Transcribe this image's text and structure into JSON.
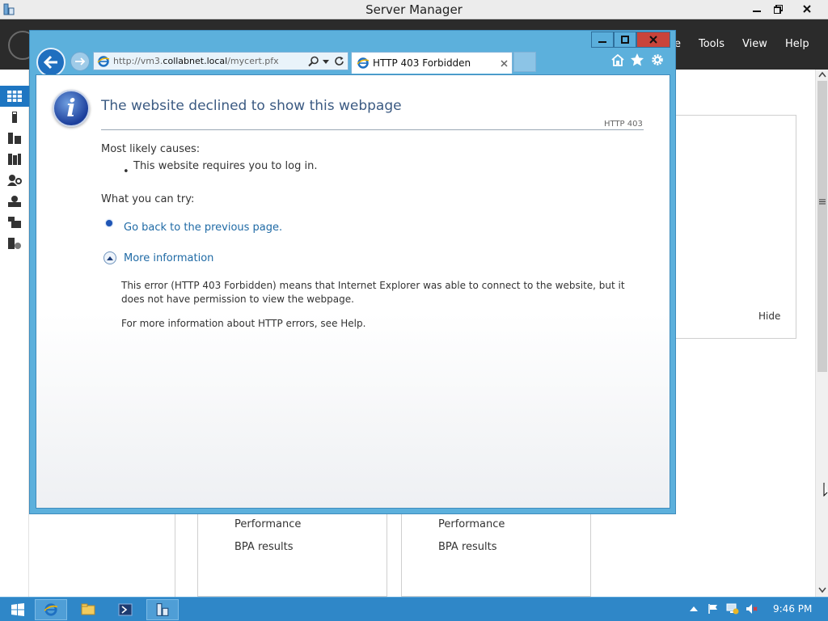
{
  "server_manager": {
    "title": "Server Manager",
    "menu": {
      "partial": "e",
      "tools": "Tools",
      "view": "View",
      "help": "Help"
    },
    "hide_link": "Hide",
    "tiles": [
      {
        "lines": [
          "Performance",
          "BPA results"
        ]
      },
      {
        "lines": [
          "Performance",
          "BPA results"
        ]
      }
    ],
    "nav_icons": [
      "dashboard-icon",
      "local-server-icon",
      "all-servers-icon",
      "file-storage-icon",
      "ad-users-icon",
      "ad-ds-icon",
      "file-services-icon",
      "iis-icon"
    ]
  },
  "ie": {
    "address": {
      "prefix": "http://vm3.",
      "domain": "collabnet.local",
      "path": "/mycert.pfx"
    },
    "tab_title": "HTTP 403 Forbidden",
    "error_page": {
      "heading": "The website declined to show this webpage",
      "code": "HTTP 403",
      "causes_label": "Most likely causes:",
      "cause_bullet": "•",
      "cause_item": "This website requires you to log in.",
      "try_label": "What you can try:",
      "go_back_link": "Go back to the previous page.",
      "more_info_link": "More information",
      "more_info_para": "This error (HTTP 403 Forbidden) means that Internet Explorer was able to connect to the website, but it does not have permission to view the webpage.",
      "help_para": "For more information about HTTP errors, see Help."
    }
  },
  "taskbar": {
    "clock": "9:46 PM",
    "buttons": [
      "start-button",
      "internet-explorer",
      "file-explorer",
      "powershell",
      "server-manager"
    ]
  },
  "colors": {
    "ie_frame": "#5cb0dc",
    "taskbar": "#2f87c8",
    "sm_header": "#2b2b2b",
    "link": "#1f6aa5"
  }
}
